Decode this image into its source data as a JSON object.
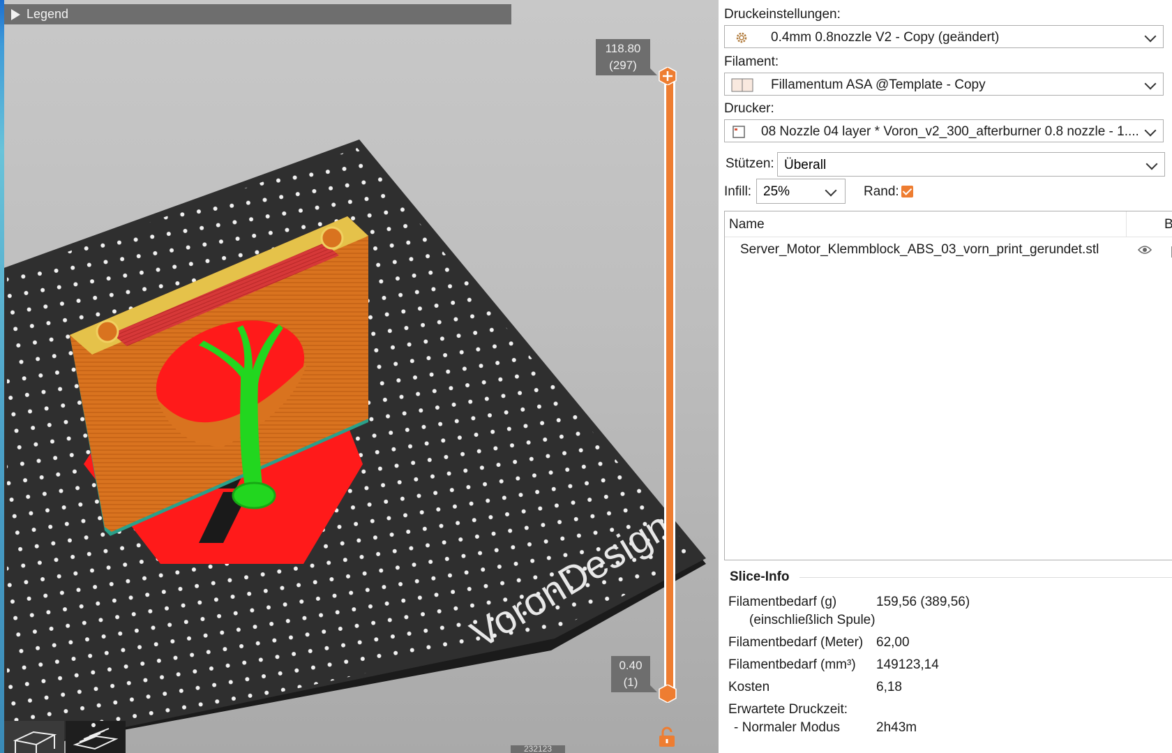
{
  "viewport": {
    "legend_label": "Legend",
    "bed_brand_text": "VoronDesign",
    "layer_slider": {
      "top_height": "118.80",
      "top_layer": "(297)",
      "bottom_height": "0.40",
      "bottom_layer": "(1)"
    },
    "bottom_counter": "232123",
    "colors": {
      "slider_accent": "#ee7d31",
      "model_perimeter": "#d9731f",
      "model_top_infill": "#d63838",
      "support_tree": "#22d61f",
      "bed_surface": "#2f2f2f",
      "voron_logo": "#ff1a1a"
    }
  },
  "sidebar": {
    "print_settings": {
      "label": "Druckeinstellungen:",
      "value": "0.4mm 0.8nozzle V2 - Copy (geändert)",
      "icon": "gear-icon"
    },
    "filament": {
      "label": "Filament:",
      "value": "Fillamentum ASA @Template - Copy",
      "icon": "filament-color-swatch-icon"
    },
    "printer": {
      "label": "Drucker:",
      "value": "08 Nozzle 04 layer * Voron_v2_300_afterburner 0.8 nozzle - 1....",
      "icon": "printer-icon"
    },
    "supports": {
      "label": "Stützen:",
      "value": "Überall"
    },
    "infill": {
      "label": "Infill:",
      "value": "25%"
    },
    "brim": {
      "label": "Rand:",
      "checked": true
    },
    "object_list": {
      "columns": [
        "Name",
        "B"
      ],
      "rows": [
        {
          "name": "Server_Motor_Klemmblock_ABS_03_vorn_print_gerundet.stl"
        }
      ]
    },
    "slice_info": {
      "title": "Slice-Info",
      "filament_g_label": "Filamentbedarf (g)",
      "filament_g_sub": "(einschließlich Spule)",
      "filament_g_value": "159,56 (389,56)",
      "filament_m_label": "Filamentbedarf (Meter)",
      "filament_m_value": "62,00",
      "filament_mm3_label": "Filamentbedarf (mm³)",
      "filament_mm3_value": "149123,14",
      "cost_label": "Kosten",
      "cost_value": "6,18",
      "print_time_label": "Erwartete Druckzeit:",
      "normal_mode_label": "- Normaler Modus",
      "normal_mode_value": "2h43m"
    }
  }
}
